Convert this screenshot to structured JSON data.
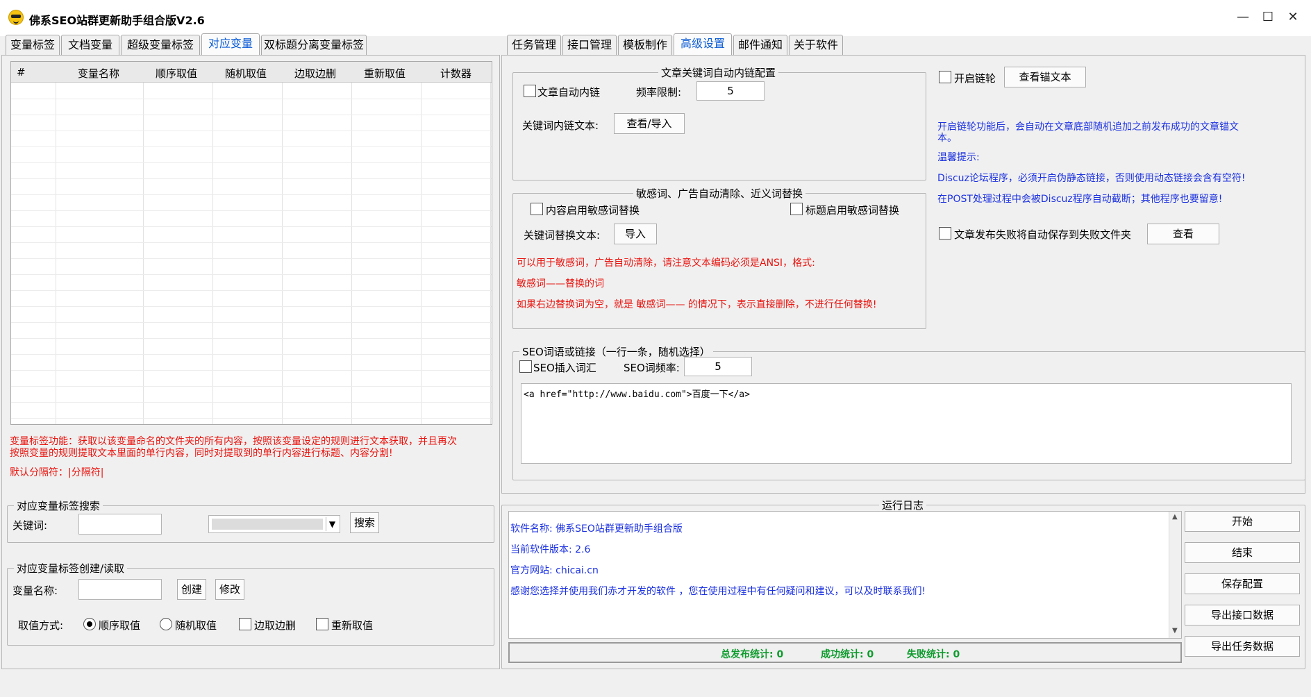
{
  "window": {
    "title": "佛系SEO站群更新助手组合版V2.6",
    "min": "—",
    "max": "☐",
    "close": "✕"
  },
  "left_tabs": [
    "变量标签",
    "文档变量",
    "超级变量标签",
    "对应变量",
    "双标题分离变量标签"
  ],
  "right_tabs": [
    "任务管理",
    "接口管理",
    "模板制作",
    "高级设置",
    "邮件通知",
    "关于软件"
  ],
  "table": {
    "columns": [
      "#",
      "变量名称",
      "顺序取值",
      "随机取值",
      "边取边删",
      "重新取值",
      "计数器"
    ]
  },
  "left_info": {
    "line1": "变量标签功能：获取以该变量命名的文件夹的所有内容，按照该变量设定的规则进行文本获取，并且再次",
    "line2": "按照变量的规则提取文本里面的单行内容，同时对提取到的单行内容进行标题、内容分割!",
    "line3": "默认分隔符：|分隔符|"
  },
  "search_box": {
    "title": "对应变量标签搜索",
    "keyword_label": "关键词:",
    "keyword_value": "",
    "search_button": "搜索"
  },
  "create_box": {
    "title": "对应变量标签创建/读取",
    "name_label": "变量名称:",
    "name_value": "",
    "create_button": "创建",
    "modify_button": "修改",
    "mode_label": "取值方式:",
    "opt_seq": "顺序取值",
    "opt_rand": "随机取值",
    "opt_del": "边取边删",
    "opt_re": "重新取值"
  },
  "inner_link": {
    "title": "文章关键词自动内链配置",
    "auto_link": "文章自动内链",
    "freq_label": "频率限制:",
    "freq_value": "5",
    "text_label": "关键词内链文本:",
    "view_import": "查看/导入"
  },
  "link_wheel": {
    "enable": "开启链轮",
    "view_anchor": "查看锚文本",
    "desc1": "开启链轮功能后，会自动在文章底部随机追加之前发布成功的文章锚文",
    "desc2": "本。",
    "tip": "温馨提示:",
    "tip1": "Discuz论坛程序，必须开启伪静态链接，否则使用动态链接会含有空符!",
    "tip2": "在POST处理过程中会被Discuz程序自动截断；其他程序也要留意!"
  },
  "sensitive": {
    "title": "敏感词、广告自动清除、近义词替换",
    "content_replace": "内容启用敏感词替换",
    "title_replace": "标题启用敏感词替换",
    "text_label": "关键词替换文本:",
    "import": "导入",
    "note1": "可以用于敏感词，广告自动清除，请注意文本编码必须是ANSI，格式:",
    "note2": "敏感词——替换的词",
    "note3": "如果右边替换词为空，就是   敏感词—— 的情况下，表示直接删除，不进行任何替换!"
  },
  "fail_save": {
    "label": "文章发布失败将自动保存到失败文件夹",
    "view": "查看"
  },
  "seo": {
    "title": "SEO词语或链接（一行一条，随机选择）",
    "insert": "SEO插入词汇",
    "freq_label": "SEO词频率:",
    "freq_value": "5",
    "content": "<a href=\"http://www.baidu.com\">百度一下</a>"
  },
  "log": {
    "title": "运行日志",
    "line1": "软件名称: 佛系SEO站群更新助手组合版",
    "line2": "当前软件版本: 2.6",
    "line3": "官方网站: chicai.cn",
    "line4": "感谢您选择并使用我们赤才开发的软件 ，您在使用过程中有任何疑问和建议，可以及时联系我们!",
    "stats": {
      "total": "总发布统计: 0",
      "success": "成功统计: 0",
      "fail": "失败统计: 0"
    }
  },
  "actions": [
    "开始",
    "结束",
    "保存配置",
    "导出接口数据",
    "导出任务数据"
  ]
}
